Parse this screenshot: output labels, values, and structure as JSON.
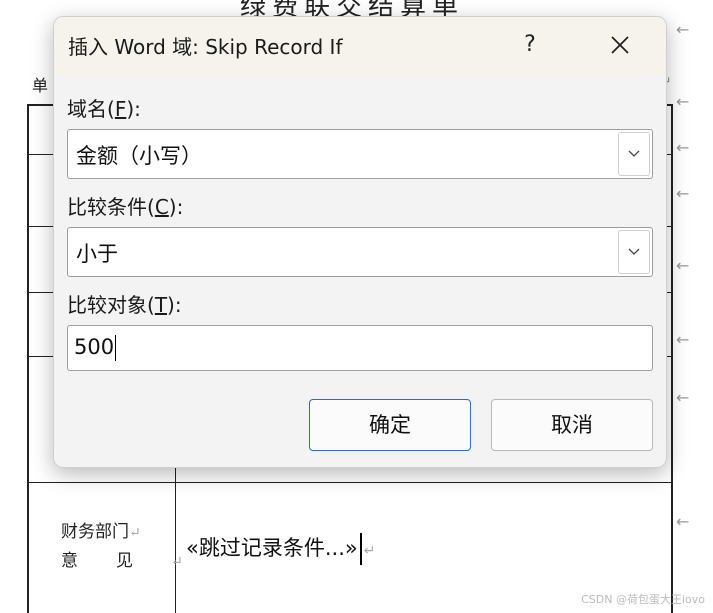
{
  "document": {
    "title": "绿费联交结算单",
    "unit_label": "单",
    "finance_label_line1": "财务部门",
    "finance_label_line2": "意见",
    "merge_field": "«跳过记录条件...»",
    "return_mark": "↵",
    "margin_arrow": "←",
    "watermark": "CSDN @荷包蛋大王iovo"
  },
  "dialog": {
    "title": "插入 Word 域: Skip Record If",
    "help_label": "?",
    "close_icon": "close-icon",
    "field_name": {
      "label_prefix": "域名(",
      "label_key": "F",
      "label_suffix": "):",
      "selected": "金额（小写）"
    },
    "comparison": {
      "label_prefix": "比较条件(",
      "label_key": "C",
      "label_suffix": "):",
      "selected": "小于"
    },
    "compare_to": {
      "label_prefix": "比较对象(",
      "label_key": "T",
      "label_suffix": "):",
      "value": "500"
    },
    "ok_label": "确定",
    "cancel_label": "取消"
  },
  "colors": {
    "dialog_bg": "#f3f3f3",
    "titlebar_bg": "#f6f3ec",
    "primary_border": "#2a6dd1"
  }
}
